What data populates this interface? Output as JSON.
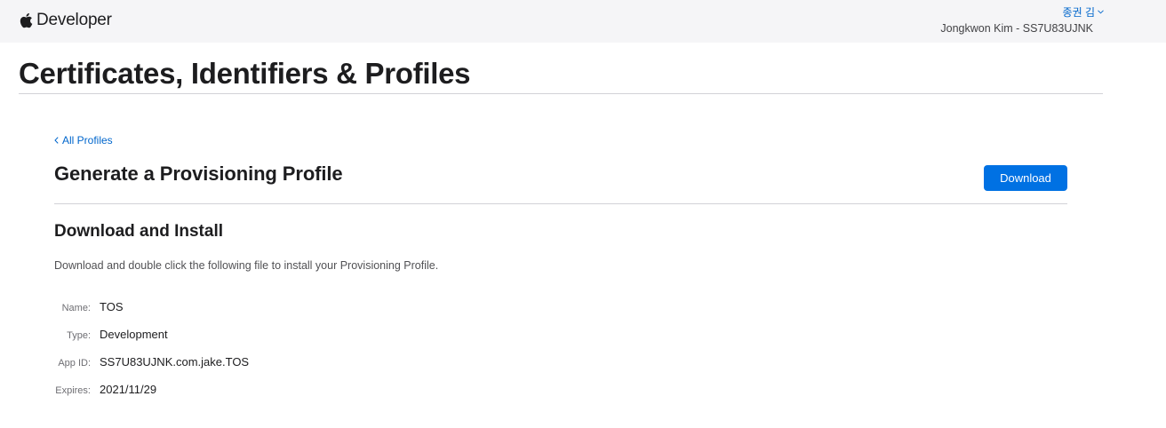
{
  "header": {
    "brand": "Developer",
    "brand_icon": "apple-logo-icon",
    "account_name": "종권 김",
    "team_info": "Jongkwon Kim - SS7U83UJNK"
  },
  "page": {
    "title": "Certificates, Identifiers & Profiles"
  },
  "content": {
    "back_link": "All Profiles",
    "section_title": "Generate a Provisioning Profile",
    "download_button": "Download",
    "subsection_title": "Download and Install",
    "description": "Download and double click the following file to install your Provisioning Profile.",
    "details": [
      {
        "label": "Name:",
        "value": "TOS"
      },
      {
        "label": "Type:",
        "value": "Development"
      },
      {
        "label": "App ID:",
        "value": "SS7U83UJNK.com.jake.TOS"
      },
      {
        "label": "Expires:",
        "value": "2021/11/29"
      }
    ]
  },
  "colors": {
    "link": "#0066cc",
    "button": "#0071e3",
    "nav_background": "#f5f5f7"
  }
}
